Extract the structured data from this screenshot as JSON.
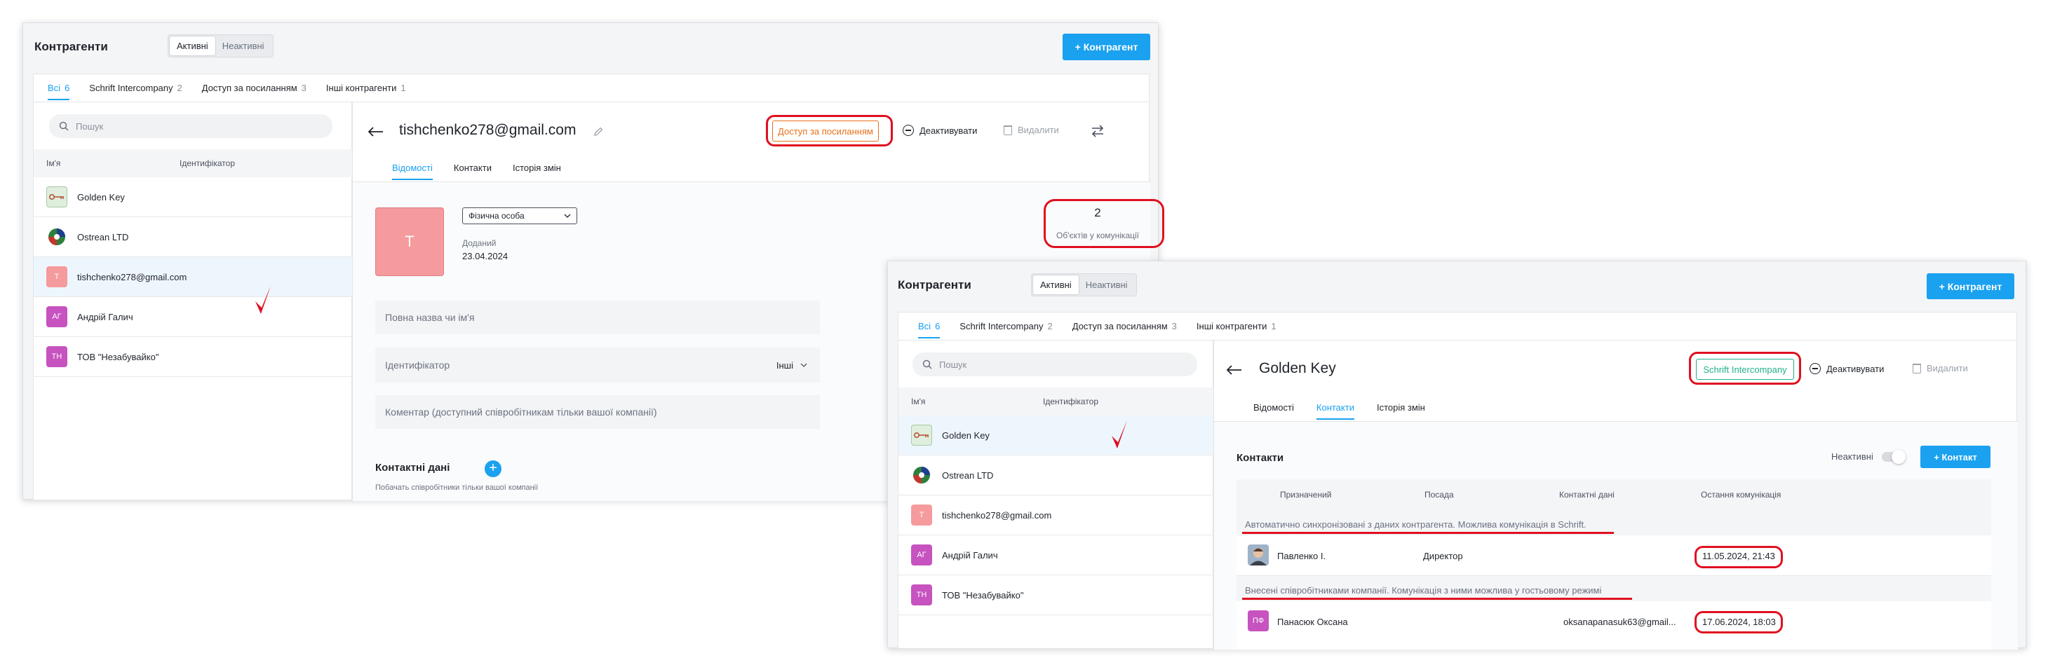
{
  "win1": {
    "title": "Контрагенти",
    "seg_active": "Активні",
    "seg_inactive": "Неактивні",
    "add_button": "+ Контрагент",
    "tabs": [
      {
        "label": "Всі",
        "count": "6"
      },
      {
        "label": "Schrift Intercompany",
        "count": "2"
      },
      {
        "label": "Доступ за посиланням",
        "count": "3"
      },
      {
        "label": "Інші контрагенти",
        "count": "1"
      }
    ],
    "search_placeholder": "Пошук",
    "col_name": "Ім'я",
    "col_id": "Ідентифікатор",
    "list": [
      {
        "name": "Golden Key",
        "avatar": ""
      },
      {
        "name": "Ostrean LTD",
        "avatar": ""
      },
      {
        "name": "tishchenko278@gmail.com",
        "avatar": "T"
      },
      {
        "name": "Андрій Галич",
        "avatar": "АГ"
      },
      {
        "name": "ТОВ \"Незабувайко\"",
        "avatar": "ТН"
      }
    ],
    "detail": {
      "title": "tishchenko278@gmail.com",
      "badge": "Доступ за посиланням",
      "deactivate": "Деактивувати",
      "delete": "Видалити",
      "tabs": [
        "Відомості",
        "Контакти",
        "Історія змін"
      ],
      "avatar_letter": "T",
      "type_select": "Фізична особа",
      "added_label": "Доданий",
      "added_date": "23.04.2024",
      "objects_count": "2",
      "objects_label": "Об'єктів у комунікації",
      "full_name_placeholder": "Повна назва чи ім'я",
      "identifier_placeholder": "Ідентифікатор",
      "identifier_type": "Інші",
      "comment_placeholder": "Коментар (доступний співробітникам тільки вашої компанії)",
      "contact_data_title": "Контактні дані",
      "contact_data_hint": "Побачать співробітники тільки вашої компанії"
    }
  },
  "win2": {
    "title": "Контрагенти",
    "seg_active": "Активні",
    "seg_inactive": "Неактивні",
    "add_button": "+ Контрагент",
    "tabs": [
      {
        "label": "Всі",
        "count": "6"
      },
      {
        "label": "Schrift Intercompany",
        "count": "2"
      },
      {
        "label": "Доступ за посиланням",
        "count": "3"
      },
      {
        "label": "Інші контрагенти",
        "count": "1"
      }
    ],
    "search_placeholder": "Пошук",
    "col_name": "Ім'я",
    "col_id": "Ідентифікатор",
    "list": [
      {
        "name": "Golden Key",
        "avatar": ""
      },
      {
        "name": "Ostrean LTD",
        "avatar": ""
      },
      {
        "name": "tishchenko278@gmail.com",
        "avatar": "T"
      },
      {
        "name": "Андрій Галич",
        "avatar": "АГ"
      },
      {
        "name": "ТОВ \"Незабувайко\"",
        "avatar": "ТН"
      }
    ],
    "detail": {
      "title": "Golden Key",
      "badge": "Schrift Intercompany",
      "deactivate": "Деактивувати",
      "delete": "Видалити",
      "tabs": [
        "Відомості",
        "Контакти",
        "Історія змін"
      ],
      "contacts_title": "Контакти",
      "inactive_label": "Неактивні",
      "add_contact": "+ Контакт",
      "columns": [
        "Призначений",
        "Посада",
        "Контактні дані",
        "Остання комунікація"
      ],
      "group1": "Автоматично синхронізовані з даних контрагента. Можлива комунікація в Schrift.",
      "group2": "Внесені співробітниками компанії. Комунікація з ними можлива у гостьовому режимі",
      "contacts": [
        {
          "name": "Павленко І.",
          "position": "Директор",
          "contact": "",
          "last": "11.05.2024, 21:43",
          "avatar": ""
        },
        {
          "name": "Панасюк Оксана",
          "position": "",
          "contact": "oksanapanasuk63@gmail...",
          "last": "17.06.2024, 18:03",
          "avatar": "ПФ"
        }
      ]
    }
  },
  "colors": {
    "accent": "#1aa1f0",
    "highlight": "#e01020",
    "badge_orange": "#e8701a",
    "badge_teal": "#22b08a"
  }
}
